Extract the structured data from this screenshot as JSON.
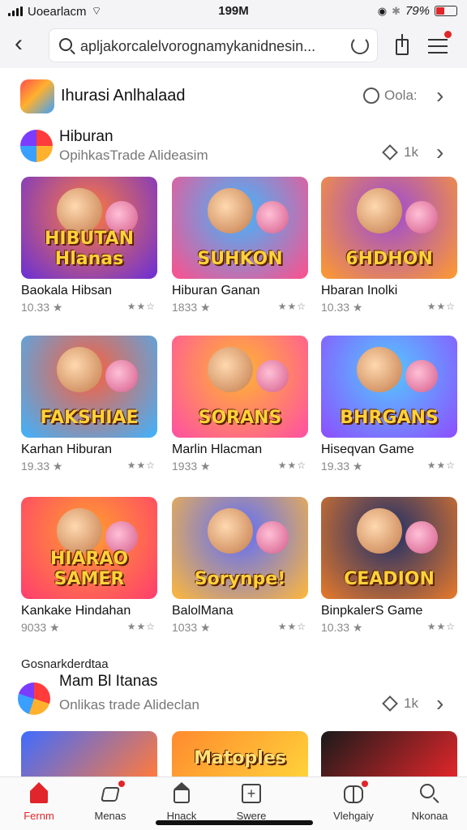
{
  "status_bar": {
    "carrier": "Uoearlacm",
    "time": "199M",
    "battery": "79%"
  },
  "header": {
    "search_value": "apljakorcalelvorognamykanidnesin...",
    "search_placeholder": "apljakorcalelvorognamykanidnesin..."
  },
  "featured_app": {
    "title": "Ihurasi Anlhalaad",
    "action": "Oola:"
  },
  "category_1": {
    "title": "Hiburan",
    "subtitle": "OpihkasTrade  Alideasim",
    "count": "1k"
  },
  "games": [
    {
      "name": "Baokala Hibsan",
      "rating": "10.33",
      "logo": "HIBUTAN Hlanas"
    },
    {
      "name": "Hiburan Ganan",
      "rating": "1833",
      "logo": "SUHKON"
    },
    {
      "name": "Hbaran Inolki",
      "rating": "10.33",
      "logo": "6HDHON"
    },
    {
      "name": "Karhan Hiburan",
      "rating": "19.33",
      "logo": "FAKSHIAE"
    },
    {
      "name": "Marlin Hlacman",
      "rating": "1933",
      "logo": "SORANS"
    },
    {
      "name": "Hiseqvan Game",
      "rating": "19.33",
      "logo": "BHRGANS"
    },
    {
      "name": "Kankake Hindahan",
      "rating": "9033",
      "logo": "HIARAO SAMER"
    },
    {
      "name": "BalolMana",
      "rating": "1033",
      "logo": "Sorynpe!"
    },
    {
      "name": "BinpkalerS Game",
      "rating": "10.33",
      "logo": "CEADION"
    }
  ],
  "section_label": "Gosnarkderdtaa",
  "category_2": {
    "title": "Mam Bl Itanas",
    "subtitle": "Onlikas trade  Alideclan",
    "count": "1k"
  },
  "partial_games": [
    {
      "logo": ""
    },
    {
      "logo": "Matoples"
    },
    {
      "logo": ""
    }
  ],
  "nav": [
    {
      "label": "Fernm",
      "icon": "home-icon",
      "active": true
    },
    {
      "label": "Menas",
      "icon": "games-icon",
      "active": false
    },
    {
      "label": "Hnack",
      "icon": "apps-icon",
      "active": false
    },
    {
      "label": "Swere",
      "icon": "plus-box-icon",
      "active": false
    },
    {
      "label": "Vlehgaiy",
      "icon": "library-icon",
      "active": false
    },
    {
      "label": "Nkonaa",
      "icon": "search-icon",
      "active": false
    }
  ],
  "colors": {
    "accent": "#e0262a",
    "text": "#1a1a1a",
    "muted": "#777777"
  }
}
